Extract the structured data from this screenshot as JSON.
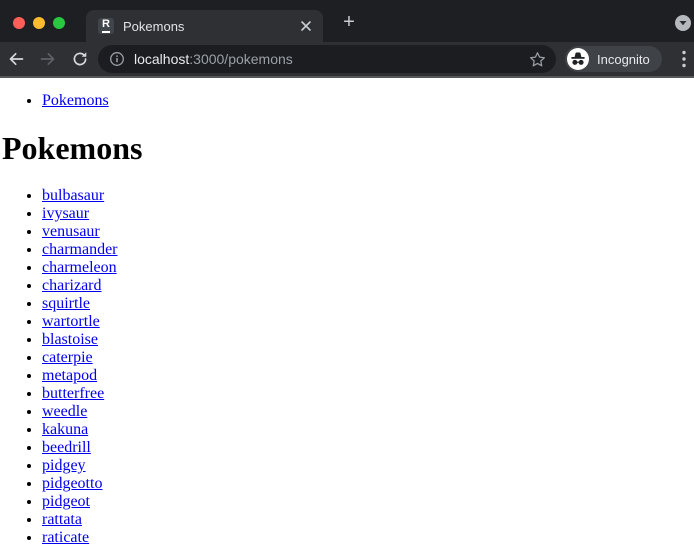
{
  "window": {
    "controls": [
      {
        "name": "close",
        "color": "#ff5f57"
      },
      {
        "name": "minimize",
        "color": "#febc2e"
      },
      {
        "name": "zoom",
        "color": "#28c840"
      }
    ]
  },
  "tabstrip": {
    "tab": {
      "title": "Pokemons",
      "favicon": "remix-logo-icon",
      "favicon_letter": "R",
      "close_icon": "x"
    },
    "new_tab_icon": "+",
    "profile_chevron_icon": "chevron-down"
  },
  "toolbar": {
    "back_icon": "back-arrow",
    "forward_icon": "forward-arrow",
    "reload_icon": "reload-circle-arrow",
    "omnibox": {
      "site_info_icon": "info-circle",
      "url_host": "localhost",
      "url_path": ":3000/pokemons",
      "bookmark_icon": "star-outline"
    },
    "incognito_badge": {
      "icon": "incognito-glasses",
      "label": "Incognito"
    },
    "menu_icon": "three-dots-vertical"
  },
  "content": {
    "nav_links": [
      "Pokemons"
    ],
    "heading": "Pokemons",
    "pokemon_links": [
      "bulbasaur",
      "ivysaur",
      "venusaur",
      "charmander",
      "charmeleon",
      "charizard",
      "squirtle",
      "wartortle",
      "blastoise",
      "caterpie",
      "metapod",
      "butterfree",
      "weedle",
      "kakuna",
      "beedrill",
      "pidgey",
      "pidgeotto",
      "pidgeot",
      "rattata",
      "raticate"
    ]
  },
  "colors": {
    "link": "#0000ee",
    "frame": "#1e1f22",
    "toolbar": "#2e3033",
    "omnibox": "#1c1d20",
    "content_bg": "#ffffff",
    "traffic_red": "#ff5f57",
    "traffic_yellow": "#febc2e",
    "traffic_green": "#28c840"
  }
}
